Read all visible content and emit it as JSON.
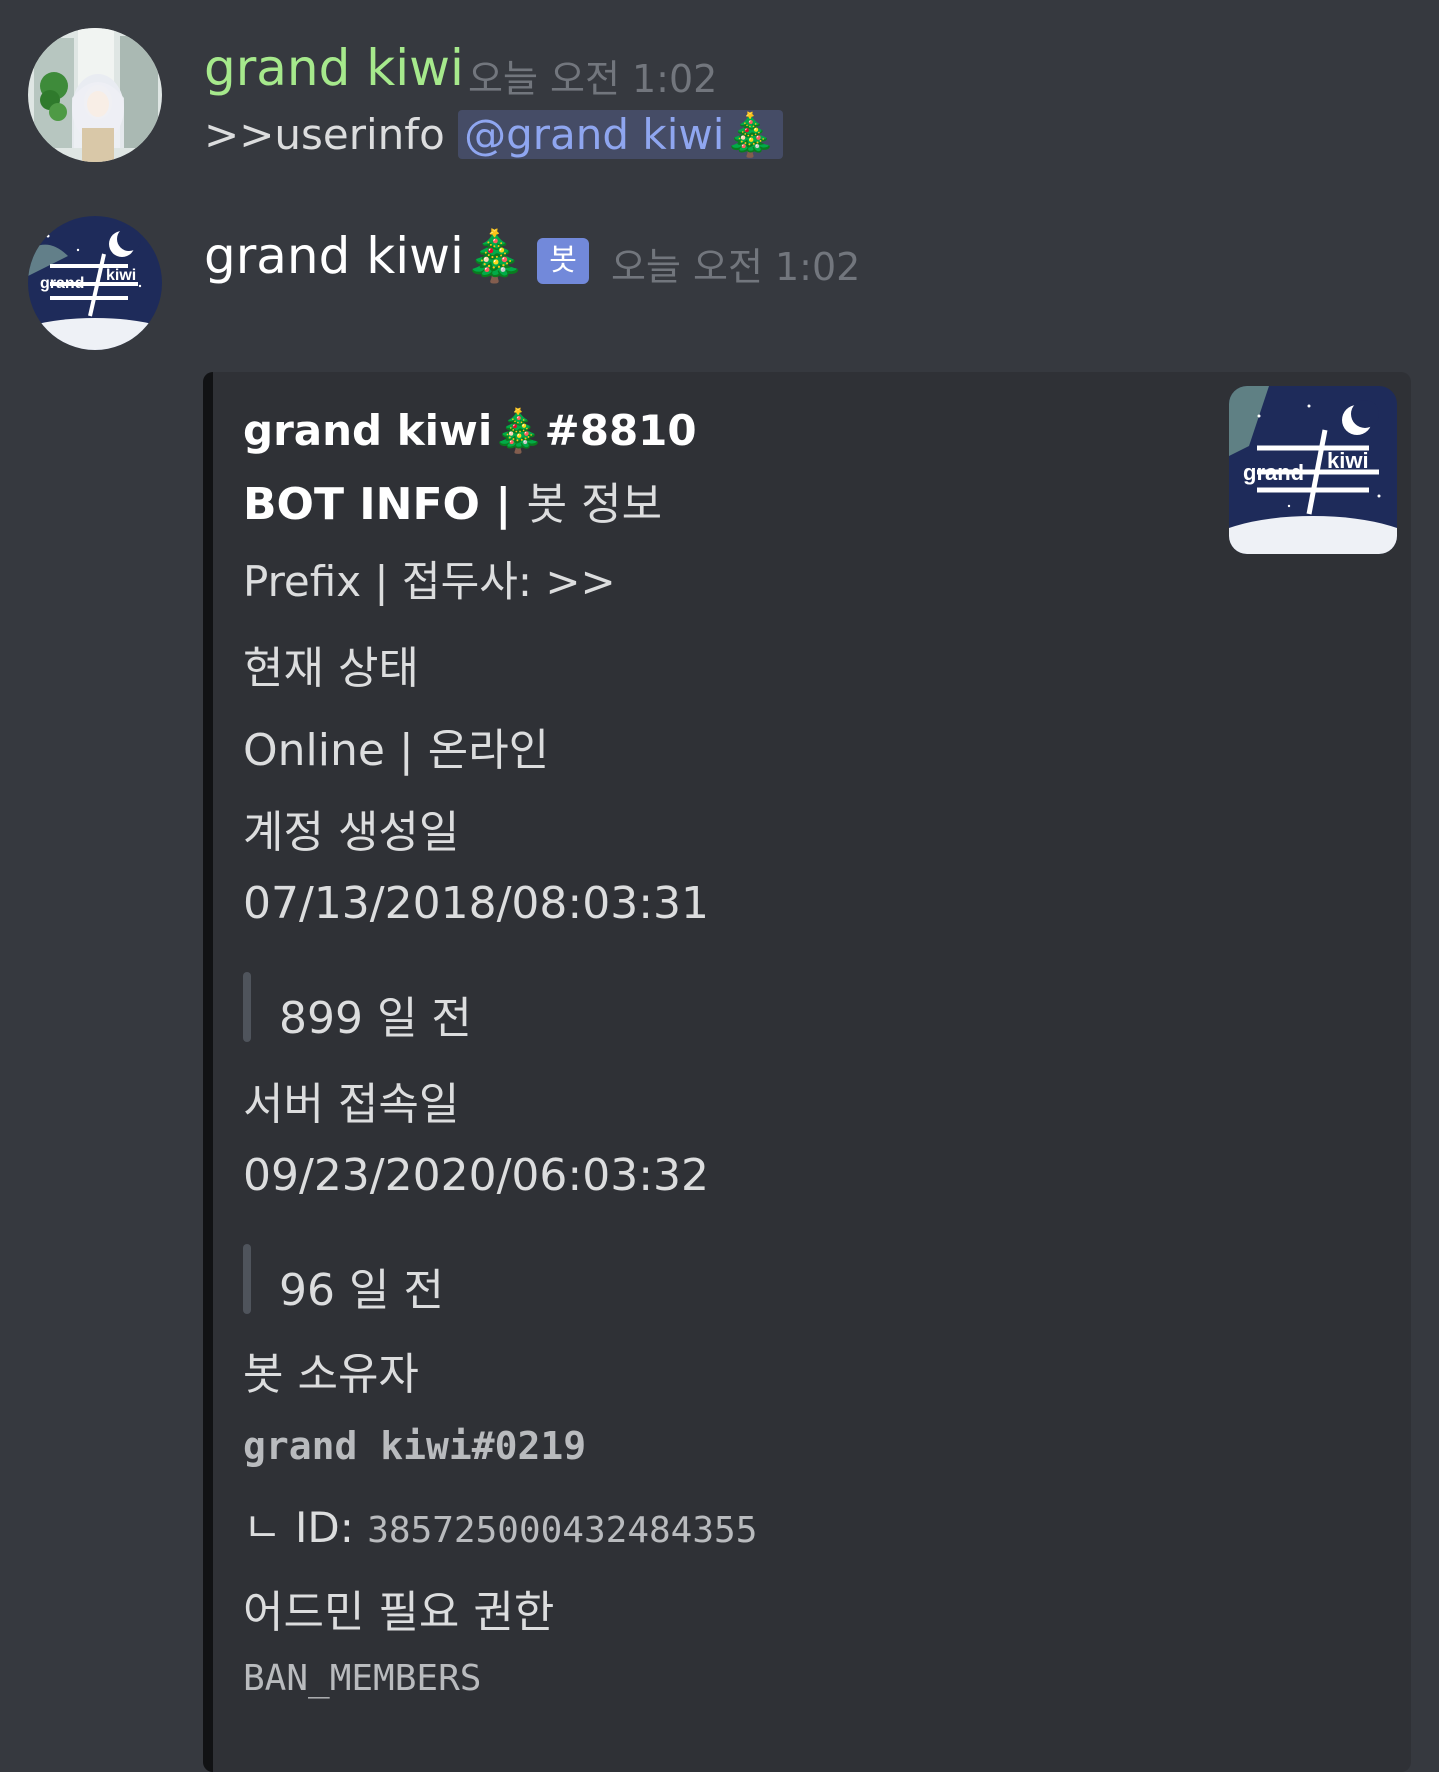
{
  "messages": [
    {
      "username": "grand kiwi",
      "timestamp": "오늘 오전 1:02",
      "content_prefix": ">>userinfo ",
      "mention": "@grand kiwi🎄",
      "username_color": "#a6e98c"
    },
    {
      "username": "grand kiwi🎄",
      "bot_tag": "봇",
      "timestamp": "오늘 오전 1:02",
      "username_color": "#ffffff"
    }
  ],
  "embed": {
    "author": "grand kiwi🎄#8810",
    "title_bold": "BOT INFO | ",
    "title_rest": "봇 정보",
    "prefix_line": "Prefix | 접두사: >>",
    "status_label": "현재 상태",
    "status_value": "Online | 온라인",
    "created_label": "계정 생성일",
    "created_value": "07/13/2018/08:03:31",
    "created_ago": "899 일 전",
    "joined_label": "서버 접속일",
    "joined_value": "09/23/2020/06:03:32",
    "joined_ago": "96 일 전",
    "owner_label": "봇 소유자",
    "owner_value": "grand kiwi#0219",
    "owner_id_prefix": "ㄴ ID: ",
    "owner_id": "385725000432484355",
    "admin_label": "어드민 필요 권한",
    "admin_value": "BAN_MEMBERS"
  },
  "logo_text": {
    "left": "grand",
    "right": "kiwi"
  },
  "colors": {
    "background": "#36393f",
    "embed_bg": "#2f3136",
    "mention_text": "#8fa6f0",
    "bot_tag": "#7289da",
    "timestamp": "#72767d"
  }
}
